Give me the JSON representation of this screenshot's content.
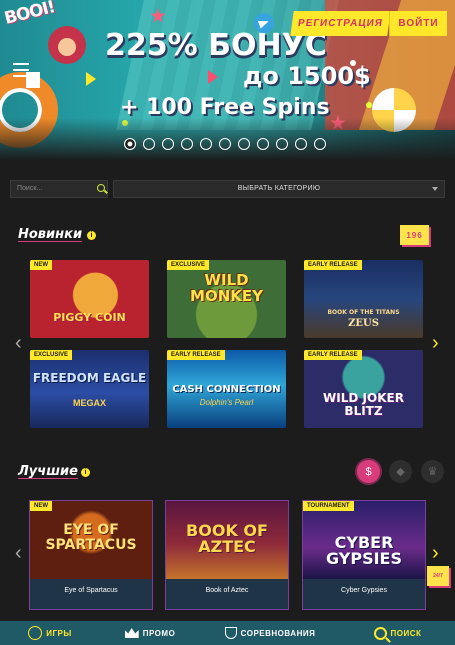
{
  "hero": {
    "logo": "BOOI!",
    "line1": "225% БОНУС",
    "line2": "до 1500$",
    "line3": "+ 100 Free Spins",
    "register_label": "РЕГИСТРАЦИЯ",
    "login_label": "ВОЙТИ",
    "slides_total": 11,
    "active_slide": 1
  },
  "filters": {
    "search_placeholder": "Поиск...",
    "category_label": "ВЫБРАТЬ КАТЕГОРИЮ"
  },
  "new_section": {
    "title": "Новинки",
    "count": "196",
    "tiles": [
      {
        "tag": "NEW",
        "title": "PIGGY COIN"
      },
      {
        "tag": "EXCLUSIVE",
        "title": "WILD MONKEY"
      },
      {
        "tag": "EARLY RELEASE",
        "title": "BOOK OF THE TITANS",
        "subtitle": "ZEUS"
      },
      {
        "tag": "EXCLUSIVE",
        "title": "FREEDOM EAGLE",
        "subtitle": "MEGAX"
      },
      {
        "tag": "EARLY RELEASE",
        "title": "CASH CONNECTION",
        "subtitle": "Dolphin's Pearl"
      },
      {
        "tag": "EARLY RELEASE",
        "title": "WILD JOKER BLITZ"
      }
    ]
  },
  "best_section": {
    "title": "Лучшие",
    "cards": [
      {
        "tag": "NEW",
        "art_title": "EYE OF SPARTACUS",
        "label": "Eye of Spartacus"
      },
      {
        "tag": "",
        "art_title": "BOOK OF AZTEC",
        "label": "Book of Aztec"
      },
      {
        "tag": "TOURNAMENT",
        "art_title": "CYBER GYPSIES",
        "label": "Cyber Gypsies"
      }
    ],
    "support_badge": "24/7"
  },
  "bottom_nav": {
    "games": "ИГРЫ",
    "promo": "ПРОМО",
    "tournaments": "СОРЕВНОВАНИЯ",
    "search": "ПОИСК"
  },
  "colors": {
    "accent_yellow": "#ffe82a",
    "accent_pink": "#d83c7b",
    "nav_bg": "#1f5a66"
  }
}
